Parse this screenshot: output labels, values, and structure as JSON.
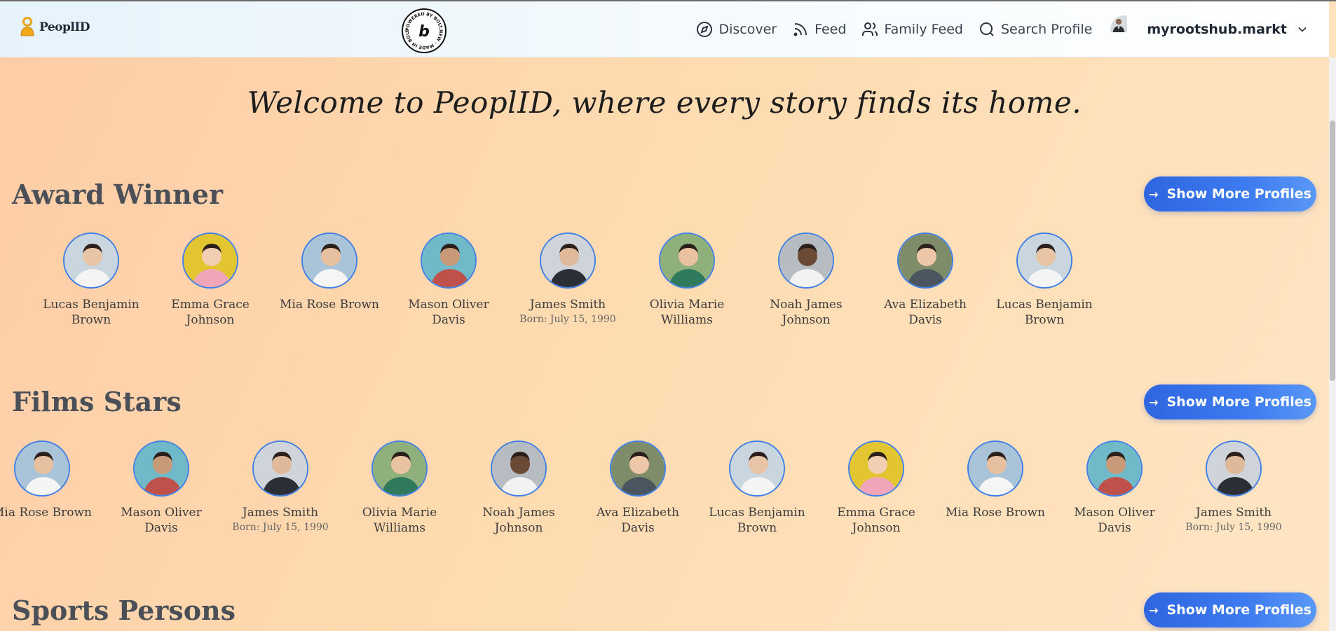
{
  "header": {
    "logo_text": "PeoplID",
    "badge_text": "POWERED BY BOLT.NEW · MADE IN BOLT.NEW",
    "nav": [
      {
        "label": "Discover",
        "icon": "compass-icon"
      },
      {
        "label": "Feed",
        "icon": "rss-icon"
      },
      {
        "label": "Family Feed",
        "icon": "users-icon"
      },
      {
        "label": "Search Profile",
        "icon": "search-icon"
      }
    ],
    "username": "myrootshub.markt"
  },
  "welcome": "Welcome to PeoplID, where every story finds its home.",
  "sections": [
    {
      "title": "Award Winner",
      "button": "Show More Profiles",
      "profiles": [
        {
          "name": "Lucas Benjamin Brown",
          "born": ""
        },
        {
          "name": "Emma Grace Johnson",
          "born": ""
        },
        {
          "name": "Mia Rose Brown",
          "born": ""
        },
        {
          "name": "Mason Oliver Davis",
          "born": ""
        },
        {
          "name": "James Smith",
          "born": "Born: July 15, 1990"
        },
        {
          "name": "Olivia Marie Williams",
          "born": ""
        },
        {
          "name": "Noah James Johnson",
          "born": ""
        },
        {
          "name": "Ava Elizabeth Davis",
          "born": ""
        },
        {
          "name": "Lucas Benjamin Brown",
          "born": ""
        }
      ]
    },
    {
      "title": "Films Stars",
      "button": "Show More Profiles",
      "profiles": [
        {
          "name": "Mia Rose Brown",
          "born": ""
        },
        {
          "name": "Mason Oliver Davis",
          "born": ""
        },
        {
          "name": "James Smith",
          "born": "Born: July 15, 1990"
        },
        {
          "name": "Olivia Marie Williams",
          "born": ""
        },
        {
          "name": "Noah James Johnson",
          "born": ""
        },
        {
          "name": "Ava Elizabeth Davis",
          "born": ""
        },
        {
          "name": "Lucas Benjamin Brown",
          "born": ""
        },
        {
          "name": "Emma Grace Johnson",
          "born": ""
        },
        {
          "name": "Mia Rose Brown",
          "born": ""
        },
        {
          "name": "Mason Oliver Davis",
          "born": ""
        },
        {
          "name": "James Smith",
          "born": "Born: July 15, 1990"
        }
      ]
    },
    {
      "title": "Sports Persons",
      "button": "Show More Profiles",
      "profiles": []
    }
  ],
  "colors": {
    "accent": "#3d7bf0",
    "photo_border": "#3f7fe8",
    "bg_start": "#fdcca6",
    "bg_end": "#fee5c4"
  }
}
